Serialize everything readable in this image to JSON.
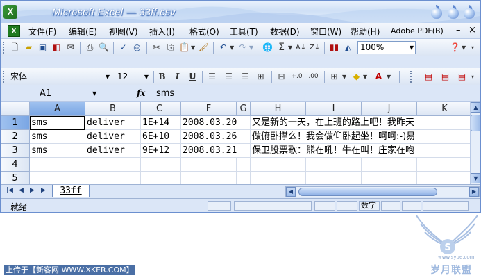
{
  "window": {
    "title": "Microsoft Excel — 33ff.csv"
  },
  "menu": {
    "items": [
      "文件(F)",
      "编辑(E)",
      "视图(V)",
      "插入(I)",
      "格式(O)",
      "工具(T)",
      "数据(D)",
      "窗口(W)",
      "帮助(H)",
      "Adobe PDF(B)"
    ],
    "minimize": "–",
    "close": "×"
  },
  "toolbar": {
    "zoom": "100%"
  },
  "format": {
    "font_name": "宋体",
    "font_size": "12"
  },
  "formula_bar": {
    "name_box": "A1",
    "fx": "fx",
    "value": "sms"
  },
  "grid": {
    "columns": [
      "A",
      "B",
      "C",
      "F",
      "G",
      "H",
      "I",
      "J",
      "K"
    ],
    "rows": [
      "1",
      "2",
      "3",
      "4",
      "5"
    ],
    "data": [
      [
        "sms",
        "deliver",
        "1E+14",
        "2008.03.20",
        "又是新的一天，在上班的路上吧！我昨天"
      ],
      [
        "sms",
        "deliver",
        "6E+10",
        "2008.03.26",
        "做俯卧撑么！我会做仰卧起坐！呵呵:-)易"
      ],
      [
        "sms",
        "deliver",
        "9E+12",
        "2008.03.21",
        "保卫股票歌：熊在吼！牛在叫！庄家在咆"
      ]
    ]
  },
  "sheet_tab": {
    "name": "33ff"
  },
  "status": {
    "ready": "就绪",
    "num_lock": "数字"
  },
  "watermark": {
    "upload_text": "上传于【新客网 WWW.XKER.COM】",
    "logo_text": "岁月联盟",
    "logo_url": "www.syue.com"
  }
}
